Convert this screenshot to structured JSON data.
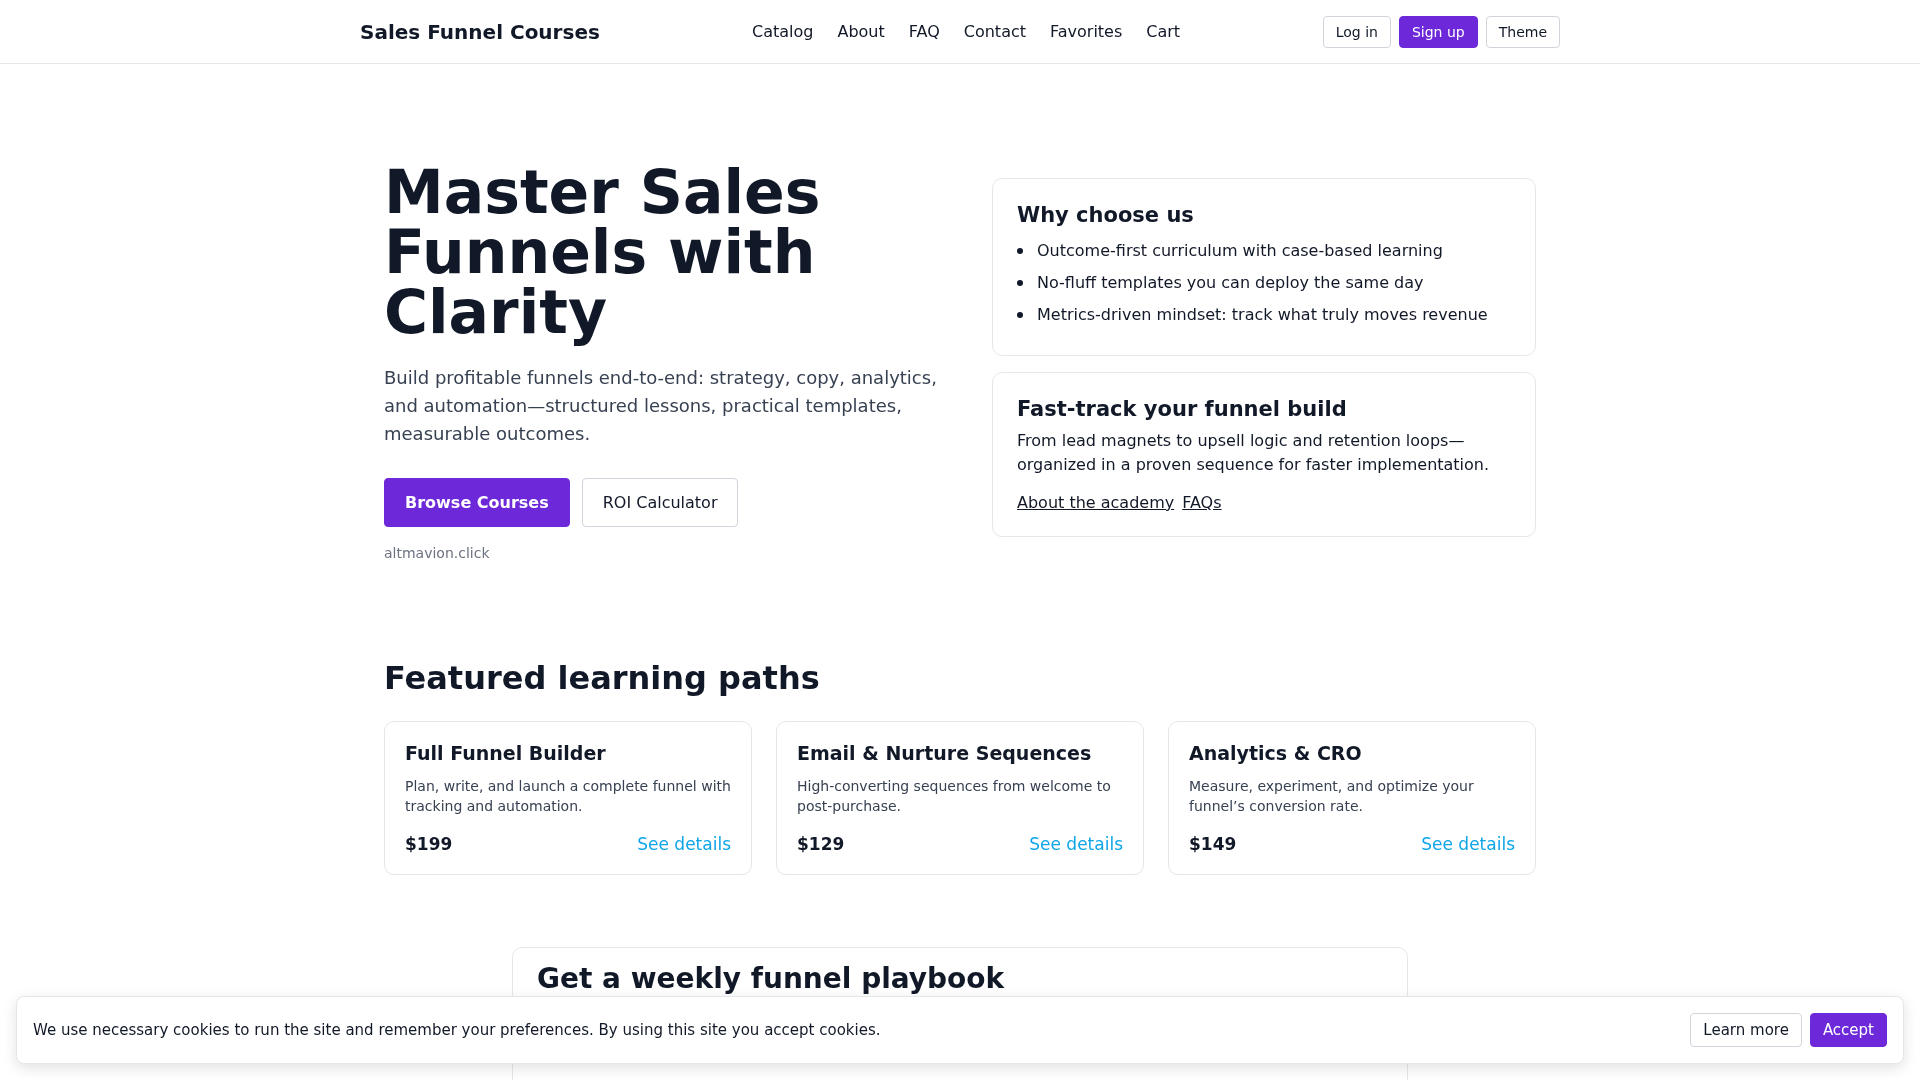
{
  "header": {
    "brand": "Sales Funnel Courses",
    "nav": [
      "Catalog",
      "About",
      "FAQ",
      "Contact",
      "Favorites",
      "Cart"
    ],
    "actions": [
      {
        "label": "Log in",
        "kind": "outline"
      },
      {
        "label": "Sign up",
        "kind": "primary"
      },
      {
        "label": "Theme",
        "kind": "outline"
      }
    ]
  },
  "hero": {
    "title": "Master Sales Funnels with Clarity",
    "lead": "Build profitable funnels end-to-end: strategy, copy, analytics, and automation—structured lessons, practical templates, measurable outcomes.",
    "buttons": [
      {
        "label": "Browse Courses",
        "kind": "primary"
      },
      {
        "label": "ROI Calculator",
        "kind": "outline"
      }
    ],
    "domain": "altmavion.click"
  },
  "why": {
    "title": "Why choose us",
    "points": [
      "Outcome-first curriculum with case-based learning",
      "No-fluff templates you can deploy the same day",
      "Metrics-driven mindset: track what truly moves revenue"
    ]
  },
  "fasttrack": {
    "title": "Fast-track your funnel build",
    "text": "From lead magnets to upsell logic and retention loops—organized in a proven sequence for faster implementation.",
    "links": [
      "About the academy",
      "FAQs"
    ]
  },
  "featured": {
    "title": "Featured learning paths",
    "courses": [
      {
        "title": "Full Funnel Builder",
        "desc": "Plan, write, and launch a complete funnel with tracking and automation.",
        "price": "$199",
        "link": "See details"
      },
      {
        "title": "Email & Nurture Sequences",
        "desc": "High-converting sequences from welcome to post-purchase.",
        "price": "$129",
        "link": "See details"
      },
      {
        "title": "Analytics & CRO",
        "desc": "Measure, experiment, and optimize your funnel’s conversion rate.",
        "price": "$149",
        "link": "See details"
      }
    ]
  },
  "newsletter": {
    "title": "Get a weekly funnel playbook"
  },
  "cookie": {
    "text": "We use necessary cookies to run the site and remember your preferences. By using this site you accept cookies.",
    "buttons": [
      {
        "label": "Learn more",
        "kind": "outline"
      },
      {
        "label": "Accept",
        "kind": "primary"
      }
    ]
  }
}
